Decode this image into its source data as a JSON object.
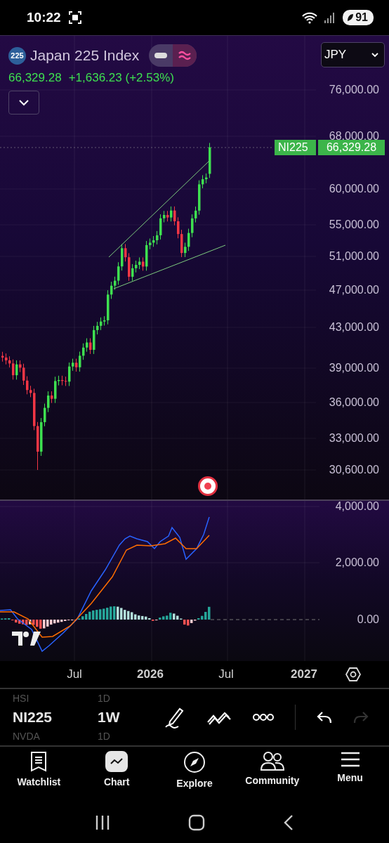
{
  "status_bar": {
    "time": "10:22",
    "battery": "91"
  },
  "symbol": {
    "badge": "225",
    "name": "Japan 225 Index",
    "price": "66,329.28",
    "change": "+1,636.23 (+2.53%)",
    "currency": "JPY"
  },
  "chart_style_toggle": [
    {
      "kind": "line",
      "selected": false
    },
    {
      "kind": "wave",
      "selected": true
    }
  ],
  "price_axis": [
    "76,000.00",
    "68,000.00",
    "60,000.00",
    "55,000.00",
    "51,000.00",
    "47,000.00",
    "43,000.00",
    "39,000.00",
    "36,000.00",
    "33,000.00",
    "30,600.00"
  ],
  "last_price_tag": {
    "symbol": "NI225",
    "price": "66,329.28"
  },
  "macd_axis": [
    "4,000.00",
    "2,000.00",
    "0.00"
  ],
  "time_axis": [
    {
      "label": "Jul",
      "major": false
    },
    {
      "label": "2026",
      "major": true
    },
    {
      "label": "Jul",
      "major": false
    },
    {
      "label": "2027",
      "major": true
    }
  ],
  "symbol_picker": [
    {
      "symbol": "HSI",
      "interval": "1D",
      "selected": false
    },
    {
      "symbol": "NI225",
      "interval": "1W",
      "selected": true
    },
    {
      "symbol": "NVDA",
      "interval": "1D",
      "selected": false
    }
  ],
  "history_buttons": [
    {
      "kind": "undo",
      "disabled": false
    },
    {
      "kind": "redo",
      "disabled": true
    }
  ],
  "tabs": [
    {
      "label": "Watchlist",
      "kind": "watchlist",
      "selected": false
    },
    {
      "label": "Chart",
      "kind": "chart",
      "selected": true
    },
    {
      "label": "Explore",
      "kind": "explore",
      "selected": false
    },
    {
      "label": "Community",
      "kind": "community",
      "selected": false
    },
    {
      "label": "Menu",
      "kind": "menu",
      "selected": false
    }
  ]
}
